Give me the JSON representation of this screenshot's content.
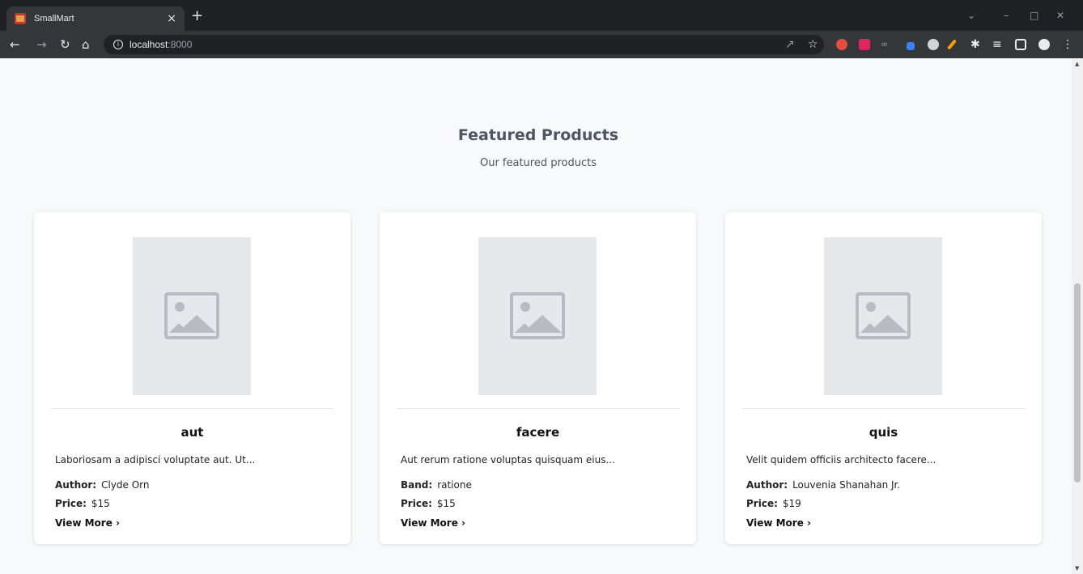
{
  "browser": {
    "tab_title": "SmallMart",
    "tab_close": "×",
    "new_tab": "+",
    "url_host": "localhost",
    "url_port": ":8000"
  },
  "section": {
    "title": "Featured Products",
    "subtitle": "Our featured products"
  },
  "products": [
    {
      "name": "aut",
      "description": "Laboriosam a adipisci voluptate aut. Ut...",
      "meta_label": "Author:",
      "meta_value": "Clyde Orn",
      "price_label": "Price:",
      "price_value": "$15",
      "cta": "View More ›"
    },
    {
      "name": "facere",
      "description": "Aut rerum ratione voluptas quisquam eius...",
      "meta_label": "Band:",
      "meta_value": "ratione",
      "price_label": "Price:",
      "price_value": "$15",
      "cta": "View More ›"
    },
    {
      "name": "quis",
      "description": "Velit quidem officiis architecto facere...",
      "meta_label": "Author:",
      "meta_value": "Louvenia Shanahan Jr.",
      "price_label": "Price:",
      "price_value": "$19",
      "cta": "View More ›"
    }
  ]
}
